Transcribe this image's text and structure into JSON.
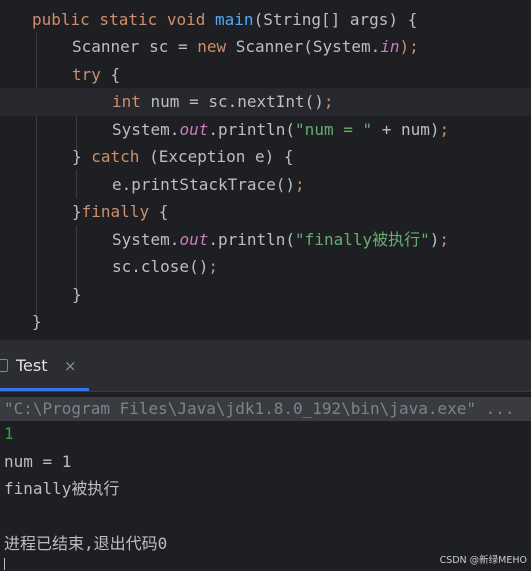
{
  "editor": {
    "colors": {
      "keyword": "#cf8e6d",
      "method": "#56a8f5",
      "static_field": "#c77dbb",
      "string": "#6aab73",
      "text": "#bcbec4"
    },
    "lines": [
      [
        [
          "keyword",
          "public static void "
        ],
        [
          "method",
          "main"
        ],
        [
          "text",
          "(String[] args) {"
        ]
      ],
      [
        [
          "text",
          "Scanner sc = "
        ],
        [
          "keyword",
          "new "
        ],
        [
          "text",
          "Scanner(System."
        ],
        [
          "static_field",
          "in"
        ],
        [
          "keyword",
          ");"
        ]
      ],
      [
        [
          "keyword",
          "try"
        ],
        [
          "text",
          " {"
        ]
      ],
      [
        [
          "keyword",
          "int "
        ],
        [
          "text",
          "num = sc.nextInt()"
        ],
        [
          "keyword",
          ";"
        ]
      ],
      [
        [
          "text",
          "System."
        ],
        [
          "static_field",
          "out"
        ],
        [
          "text",
          ".println("
        ],
        [
          "string",
          "\"num = \""
        ],
        [
          "text",
          " + num)"
        ],
        [
          "keyword",
          ";"
        ]
      ],
      [
        [
          "text",
          "} "
        ],
        [
          "keyword",
          "catch "
        ],
        [
          "text",
          "(Exception e) {"
        ]
      ],
      [
        [
          "text",
          "e.printStackTrace()"
        ],
        [
          "keyword",
          ";"
        ]
      ],
      [
        [
          "text",
          "}"
        ],
        [
          "keyword",
          "finally "
        ],
        [
          "text",
          "{"
        ]
      ],
      [
        [
          "text",
          "System."
        ],
        [
          "static_field",
          "out"
        ],
        [
          "text",
          ".println("
        ],
        [
          "string",
          "\"finally被执行\""
        ],
        [
          "text",
          ")"
        ],
        [
          "keyword",
          ";"
        ]
      ],
      [
        [
          "text",
          "sc.close()"
        ],
        [
          "keyword",
          ";"
        ]
      ],
      [
        [
          "text",
          "}"
        ]
      ],
      [
        [
          "text",
          "}"
        ]
      ]
    ]
  },
  "run_panel": {
    "tab_label": "Test",
    "tab_close": "×",
    "icon": "run-config-icon"
  },
  "console": {
    "command": "\"C:\\Program Files\\Java\\jdk1.8.0_192\\bin\\java.exe\" ...",
    "input_echo": "1",
    "output_line_1": "num = 1",
    "output_line_2": "finally被执行",
    "exit_message": "进程已结束,退出代码0"
  },
  "watermark": "CSDN @新绿MEHO"
}
